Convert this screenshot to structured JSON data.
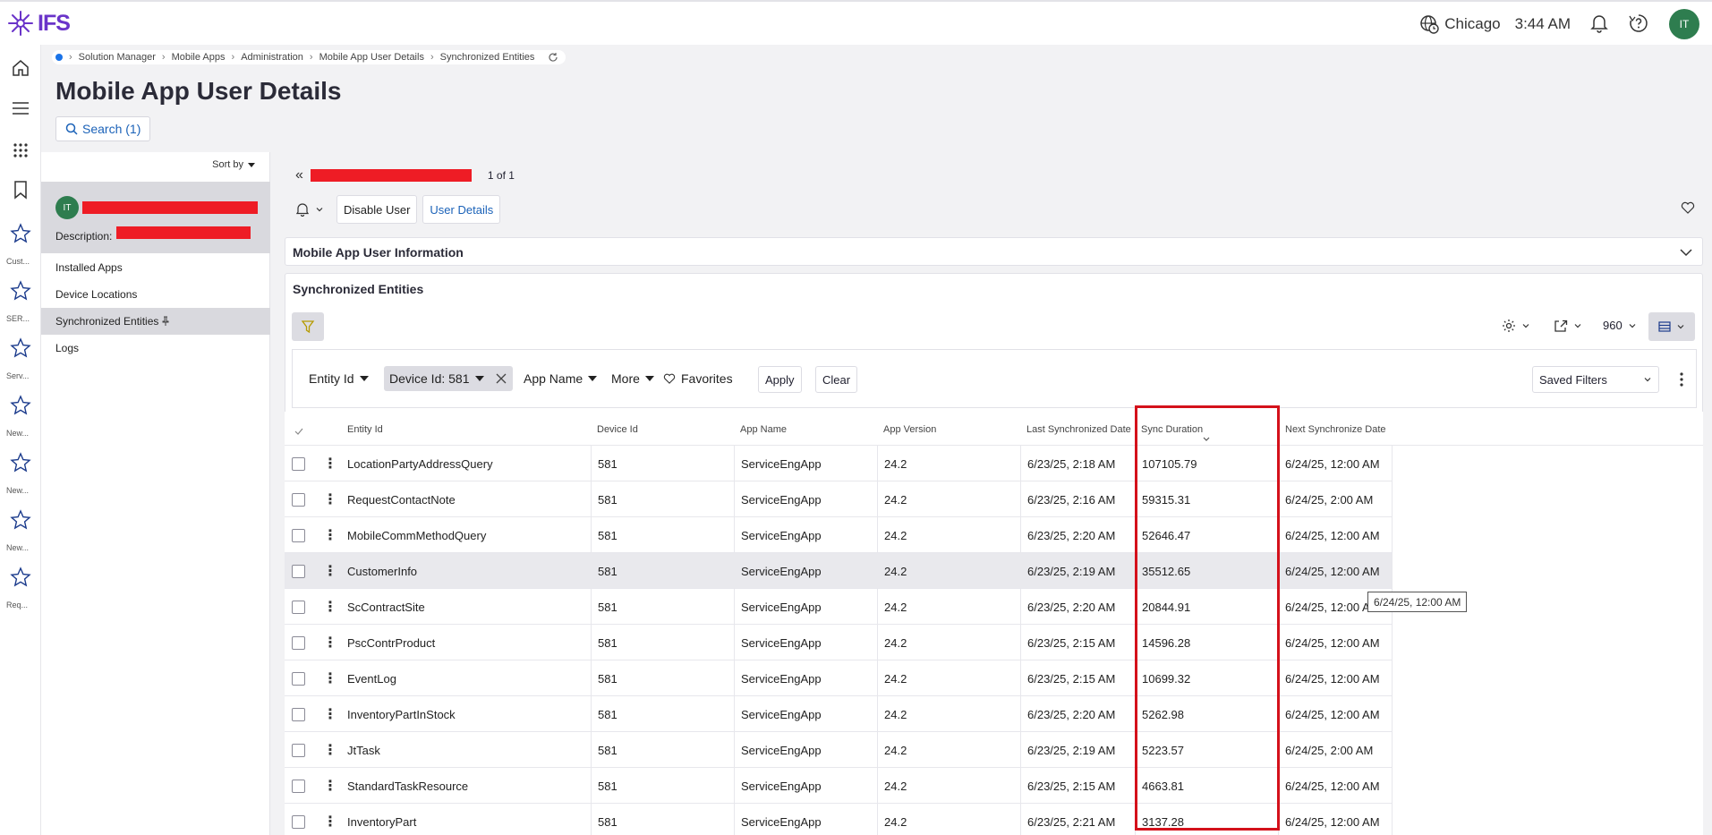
{
  "app": {
    "logo_text": "IFS",
    "brand_color": "#6a34c9"
  },
  "topbar": {
    "location": "Chicago",
    "time": "3:44 AM",
    "user_initials": "IT"
  },
  "rail": {
    "labels": [
      "Cust...",
      "SER...",
      "Serv...",
      "New...",
      "New...",
      "New...",
      "Req..."
    ]
  },
  "breadcrumb": [
    "Solution Manager",
    "Mobile Apps",
    "Administration",
    "Mobile App User Details",
    "Synchronized Entities"
  ],
  "page": {
    "title": "Mobile App User Details",
    "search_label": "Search (1)"
  },
  "left_panel": {
    "sort_label": "Sort by",
    "card_initials": "IT",
    "description_label": "Description:",
    "nav": [
      "Installed Apps",
      "Device Locations",
      "Synchronized Entities",
      "Logs"
    ]
  },
  "record_nav": {
    "count": "1 of 1"
  },
  "actions": {
    "disable_user": "Disable User",
    "user_details": "User Details"
  },
  "sections": {
    "info_title": "Mobile App User Information",
    "entities_title": "Synchronized Entities"
  },
  "toolbar": {
    "page_size": "960"
  },
  "filters": {
    "entity_id": "Entity Id",
    "device_id": "Device Id: 581",
    "app_name": "App Name",
    "more": "More",
    "favorites": "Favorites",
    "apply": "Apply",
    "clear": "Clear",
    "saved_filters": "Saved Filters"
  },
  "table": {
    "columns": [
      "Entity Id",
      "Device Id",
      "App Name",
      "App Version",
      "Last Synchronized Date",
      "Sync Duration",
      "Next Synchronize Date"
    ],
    "rows": [
      [
        "LocationPartyAddressQuery",
        "581",
        "ServiceEngApp",
        "24.2",
        "6/23/25, 2:18 AM",
        "107105.79",
        "6/24/25, 12:00 AM"
      ],
      [
        "RequestContactNote",
        "581",
        "ServiceEngApp",
        "24.2",
        "6/23/25, 2:16 AM",
        "59315.31",
        "6/24/25, 2:00 AM"
      ],
      [
        "MobileCommMethodQuery",
        "581",
        "ServiceEngApp",
        "24.2",
        "6/23/25, 2:20 AM",
        "52646.47",
        "6/24/25, 12:00 AM"
      ],
      [
        "CustomerInfo",
        "581",
        "ServiceEngApp",
        "24.2",
        "6/23/25, 2:19 AM",
        "35512.65",
        "6/24/25, 12:00 AM"
      ],
      [
        "ScContractSite",
        "581",
        "ServiceEngApp",
        "24.2",
        "6/23/25, 2:20 AM",
        "20844.91",
        "6/24/25, 12:00 A"
      ],
      [
        "PscContrProduct",
        "581",
        "ServiceEngApp",
        "24.2",
        "6/23/25, 2:15 AM",
        "14596.28",
        "6/24/25, 12:00 AM"
      ],
      [
        "EventLog",
        "581",
        "ServiceEngApp",
        "24.2",
        "6/23/25, 2:15 AM",
        "10699.32",
        "6/24/25, 12:00 AM"
      ],
      [
        "InventoryPartInStock",
        "581",
        "ServiceEngApp",
        "24.2",
        "6/23/25, 2:20 AM",
        "5262.98",
        "6/24/25, 12:00 AM"
      ],
      [
        "JtTask",
        "581",
        "ServiceEngApp",
        "24.2",
        "6/23/25, 2:19 AM",
        "5223.57",
        "6/24/25, 2:00 AM"
      ],
      [
        "StandardTaskResource",
        "581",
        "ServiceEngApp",
        "24.2",
        "6/23/25, 2:15 AM",
        "4663.81",
        "6/24/25, 12:00 AM"
      ],
      [
        "InventoryPart",
        "581",
        "ServiceEngApp",
        "24.2",
        "6/23/25, 2:21 AM",
        "3137.28",
        "6/24/25, 12:00 AM"
      ]
    ],
    "tooltip": "6/24/25, 12:00 AM",
    "highlight_color": "#d4111b"
  }
}
